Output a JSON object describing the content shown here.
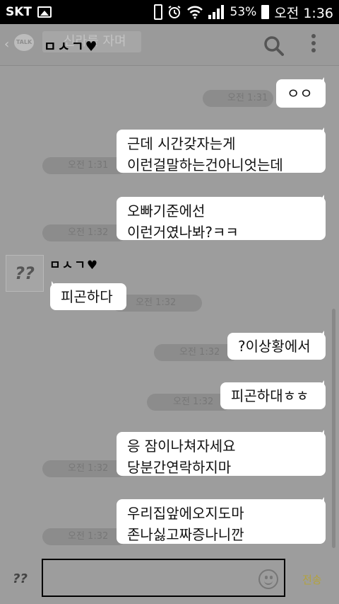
{
  "status_bar": {
    "carrier": "SKT",
    "battery": "53%",
    "time": "오전 1:36"
  },
  "header": {
    "title": "ㅁㅅㄱ♥",
    "ghost_text": "신라를 자며",
    "talk_badge": "TALK"
  },
  "messages": [
    {
      "side": "right",
      "lines": [
        "ㅇㅇ"
      ],
      "time": "오전 1:31"
    },
    {
      "side": "right",
      "lines": [
        "근데 시간갖자는게",
        "이런걸말하는건아니엇는데"
      ],
      "time": "오전 1:31"
    },
    {
      "side": "right",
      "lines": [
        "오빠기준에선",
        "이런거였나봐?ㅋㅋ"
      ],
      "time": "오전 1:32"
    },
    {
      "side": "left",
      "sender": "ㅁㅅㄱ♥",
      "avatar_text": "??",
      "lines": [
        "피곤하다"
      ],
      "time": "오전 1:32"
    },
    {
      "side": "right",
      "lines": [
        "?이상황에서"
      ],
      "time": "오전 1:32"
    },
    {
      "side": "right",
      "lines": [
        "피곤하대ㅎㅎ"
      ],
      "time": "오전 1:32"
    },
    {
      "side": "right",
      "lines": [
        "응 잠이나쳐자세요",
        "당분간연락하지마"
      ],
      "time": "오전 1:32"
    },
    {
      "side": "right",
      "lines": [
        "우리집앞에오지도마",
        "존나싫고짜증나니깐"
      ],
      "time": "오전 1:32"
    }
  ],
  "input_bar": {
    "plus_label": "??",
    "send_label": "전송"
  },
  "colors": {
    "overlay_bg": "#9d9d9d",
    "bubble": "#ffffff",
    "send": "#b4a23c"
  }
}
